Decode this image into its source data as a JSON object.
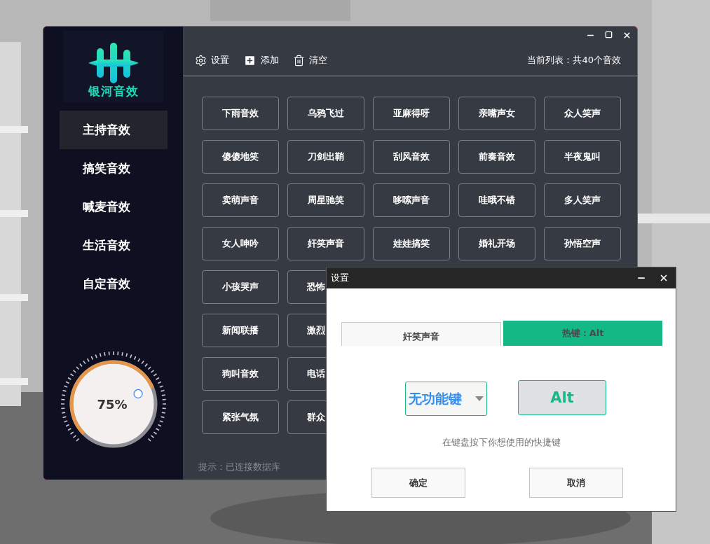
{
  "app": {
    "logo_text": "银河音效"
  },
  "toolbar": {
    "items": [
      {
        "kind": "settings",
        "label": "设置"
      },
      {
        "kind": "add",
        "label": "添加"
      },
      {
        "kind": "clear",
        "label": "清空"
      }
    ],
    "summary": "当前列表：共40个音效"
  },
  "sidebar": {
    "items": [
      {
        "label": "主持音效",
        "selected": true
      },
      {
        "label": "搞笑音效",
        "selected": false
      },
      {
        "label": "喊麦音效",
        "selected": false
      },
      {
        "label": "生活音效",
        "selected": false
      },
      {
        "label": "自定音效",
        "selected": false
      }
    ]
  },
  "volume": {
    "level": 0.75,
    "reading": "75%"
  },
  "sound_rows": [
    [
      {
        "label": "下雨音效"
      },
      {
        "label": "乌鸦飞过"
      },
      {
        "label": "亚麻得呀"
      },
      {
        "label": "亲嘴声女"
      },
      {
        "label": "众人笑声"
      }
    ],
    [
      {
        "label": "傻傻地笑"
      },
      {
        "label": "刀剑出鞘"
      },
      {
        "label": "刮风音效"
      },
      {
        "label": "前奏音效"
      },
      {
        "label": "半夜鬼叫"
      }
    ],
    [
      {
        "label": "卖萌声音"
      },
      {
        "label": "周星驰笑"
      },
      {
        "label": "哆嗦声音"
      },
      {
        "label": "哇哦不错"
      },
      {
        "label": "多人笑声"
      }
    ],
    [
      {
        "label": "女人呻吟"
      },
      {
        "label": "奸笑声音"
      },
      {
        "label": "娃娃搞笑"
      },
      {
        "label": "婚礼开场"
      },
      {
        "label": "孙悟空声"
      }
    ],
    [
      {
        "label": "小孩哭声"
      },
      {
        "label": "恐怖",
        "clipped": true
      }
    ],
    [
      {
        "label": "新闻联播"
      },
      {
        "label": "激烈",
        "clipped": true
      }
    ],
    [
      {
        "label": "狗叫音效"
      },
      {
        "label": "电话",
        "clipped": true
      }
    ],
    [
      {
        "label": "紧张气氛"
      },
      {
        "label": "群众",
        "clipped": true
      }
    ]
  ],
  "status": "提示：已连接数据库",
  "dialog": {
    "title": "设置",
    "sound_name": "奸笑声音",
    "hotkey_label": "热键：Alt",
    "modifier": {
      "value": "无功能键"
    },
    "key": "Alt",
    "hint": "在键盘按下你想使用的快捷键",
    "buttons": [
      "确定",
      "取消"
    ]
  }
}
